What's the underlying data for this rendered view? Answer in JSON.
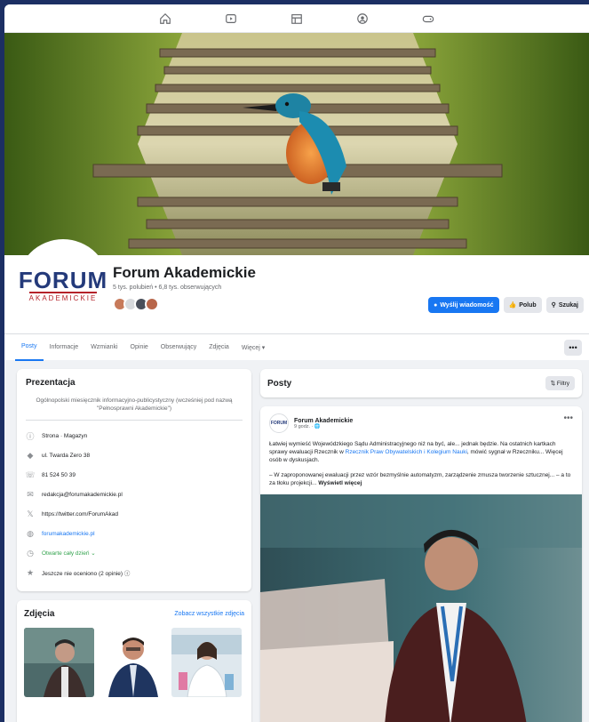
{
  "nav": {
    "icons": [
      "home-icon",
      "video-icon",
      "marketplace-icon",
      "groups-icon",
      "gaming-icon"
    ]
  },
  "page": {
    "name": "Forum Akademickie",
    "stats": "5 tys. polubień • 6,8 tys. obserwujących",
    "logo_main": "FORUM",
    "logo_sub": "AKADEMICKIE"
  },
  "actions": {
    "primary": "Wyślij wiadomość",
    "like": "Polub",
    "search": "Szukaj"
  },
  "tabs": [
    "Posty",
    "Informacje",
    "Wzmianki",
    "Opinie",
    "Obserwujący",
    "Zdjęcia",
    "Więcej ▾"
  ],
  "intro": {
    "title": "Prezentacja",
    "description": "Ogólnopolski miesięcznik informacyjno-publicystyczny (wcześniej pod nazwą \"Pełnosprawni Akademickie\")",
    "items": [
      {
        "icon": "info-icon",
        "text": "Strona · Magazyn",
        "style": ""
      },
      {
        "icon": "location-icon",
        "text": "ul. Twarda Zero 38",
        "style": ""
      },
      {
        "icon": "phone-icon",
        "text": "81 524 50 39",
        "style": ""
      },
      {
        "icon": "mail-icon",
        "text": "redakcja@forumakademickie.pl",
        "style": ""
      },
      {
        "icon": "x-icon",
        "text": "https://twitter.com/ForumAkad",
        "style": ""
      },
      {
        "icon": "globe-icon",
        "text": "forumakademickie.pl",
        "style": "link"
      },
      {
        "icon": "clock-icon",
        "text": "Otwarte cały dzień ⌄",
        "style": "green"
      },
      {
        "icon": "star-icon",
        "text": "Jeszcze nie oceniono (2 opinie) ⓘ",
        "style": ""
      }
    ]
  },
  "photos": {
    "title": "Zdjęcia",
    "link": "Zobacz wszystkie zdjęcia"
  },
  "posts": {
    "title": "Posty",
    "filter": "⇅ Filtry",
    "post": {
      "author": "Forum Akademickie",
      "time": "9 godz. · 🌐",
      "logo": "FORUM",
      "text1": "Łatwiej wymieść Wojewódzkiego Sądu Administracyjnego niż na być, ale... jednak będzie. Na ostatnich kartkach sprawy ewaluacji Rzecznik w ",
      "text_link": "Rzecznik Praw Obywatelskich i Kolegium Nauki",
      "text2": ", mówić sygnał w Rzeczniku... Więcej osób w dyskusjach.",
      "text3": "– W zaproponowanej ewaluacji przez wzór bezmyślnie automatyzm, zarządzenie zmusza tworzenie sztucznej... – a to za tłoku projekcji... ",
      "more": "Wyświetl więcej"
    }
  },
  "colors": {
    "accent": "#1877f2",
    "border_frame": "#1c2f63",
    "logo_blue": "#243a7a",
    "logo_red": "#b5232a"
  }
}
